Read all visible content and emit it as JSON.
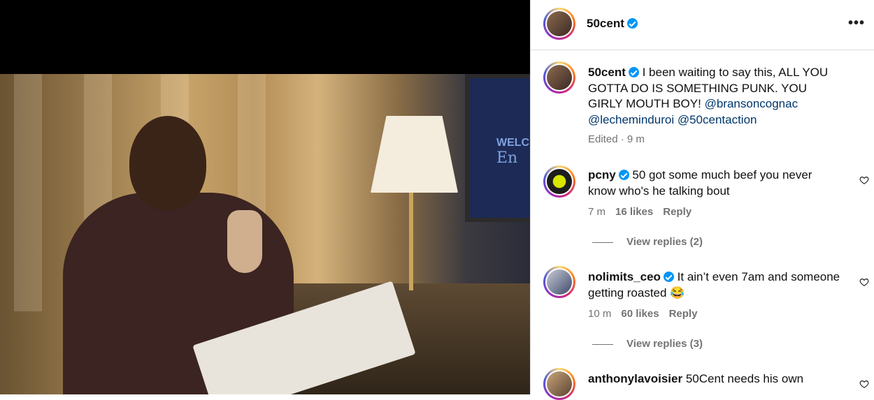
{
  "post": {
    "author": "50cent",
    "caption_text": "I been waiting to say this, ALL YOU GOTTA DO IS SOMETHING PUNK. YOU GIRLY MOUTH BOY!",
    "mentions": [
      "@bransoncognac",
      "@lecheminduroi",
      "@50centaction"
    ],
    "meta": "Edited · 9 m",
    "photo_tv_text": "WELC",
    "photo_tv_text2": "En"
  },
  "header": {
    "username": "50cent",
    "more_label": "•••"
  },
  "comments": [
    {
      "user": "pcny",
      "verified": true,
      "text": "50 got some much beef you never know who's he talking bout",
      "time": "7 m",
      "likes": "16 likes",
      "reply": "Reply",
      "view_replies": "View replies (2)"
    },
    {
      "user": "nolimits_ceo",
      "verified": true,
      "text": "It ain’t even 7am and someone getting roasted 😂",
      "time": "10 m",
      "likes": "60 likes",
      "reply": "Reply",
      "view_replies": "View replies (3)"
    },
    {
      "user": "anthonylavoisier",
      "verified": false,
      "text": "50Cent needs his own"
    }
  ],
  "colors": {
    "verified": "#0095f6",
    "link": "#00376b",
    "muted": "#737373",
    "border": "#dbdbdb"
  }
}
